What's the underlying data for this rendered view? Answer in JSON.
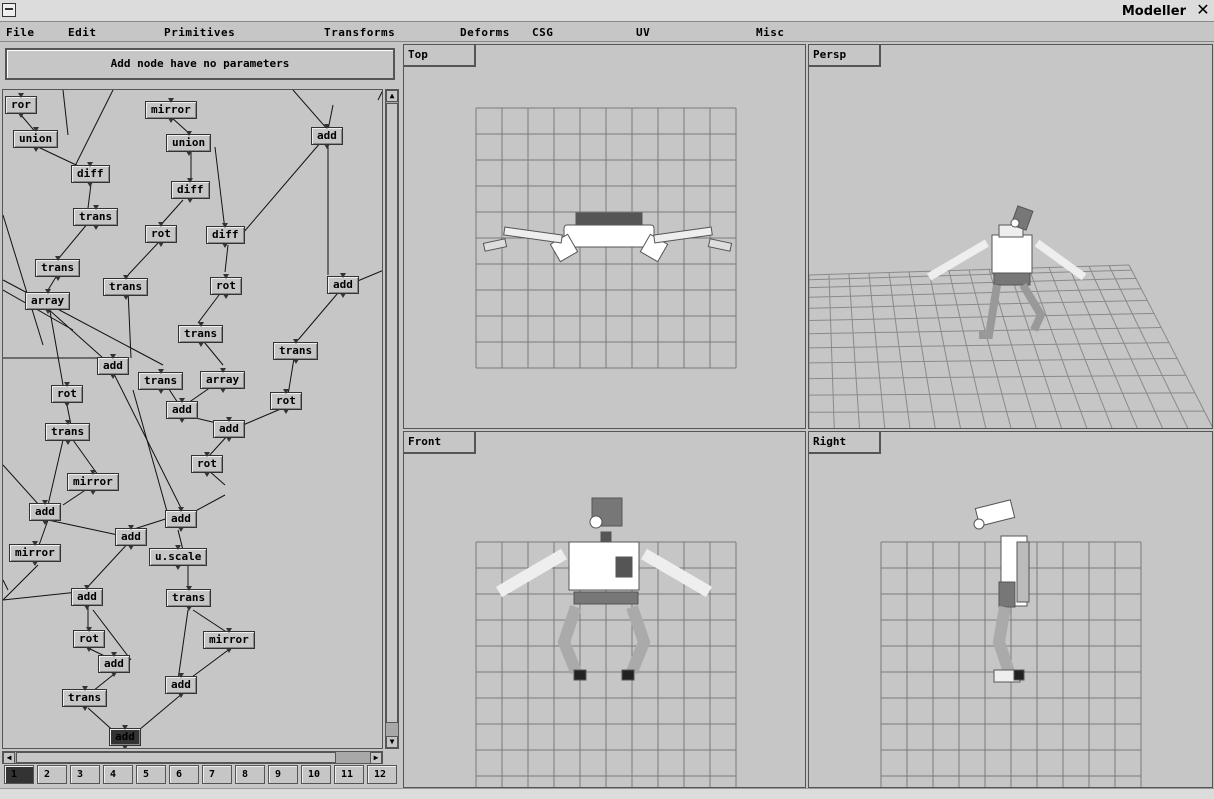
{
  "window": {
    "title": "Modeller"
  },
  "menu": [
    "File",
    "Edit",
    "Primitives",
    "Transforms",
    "Deforms",
    "CSG",
    "UV",
    "Misc"
  ],
  "info": {
    "message": "Add node have no parameters"
  },
  "nodes": [
    "ror",
    "mirror",
    "union",
    "union",
    "add",
    "diff",
    "diff",
    "rot",
    "diff",
    "trans",
    "trans",
    "rot",
    "add",
    "array",
    "trans",
    "trans",
    "add",
    "trans",
    "array",
    "rot",
    "add",
    "add",
    "rot",
    "trans",
    "rot",
    "mirror",
    "trans",
    "add",
    "add",
    "add",
    "mirror",
    "u.scale",
    "add",
    "trans",
    "rot",
    "mirror",
    "add",
    "add",
    "trans",
    "add"
  ],
  "page_tabs": [
    "1",
    "2",
    "3",
    "4",
    "5",
    "6",
    "7",
    "8",
    "9",
    "10",
    "11",
    "12"
  ],
  "viewports": {
    "top": "Top",
    "persp": "Persp",
    "front": "Front",
    "right": "Right"
  },
  "colors": {
    "background": "#c6c6c6",
    "grid": "#7a7a7a",
    "selected_node": "#333333"
  }
}
